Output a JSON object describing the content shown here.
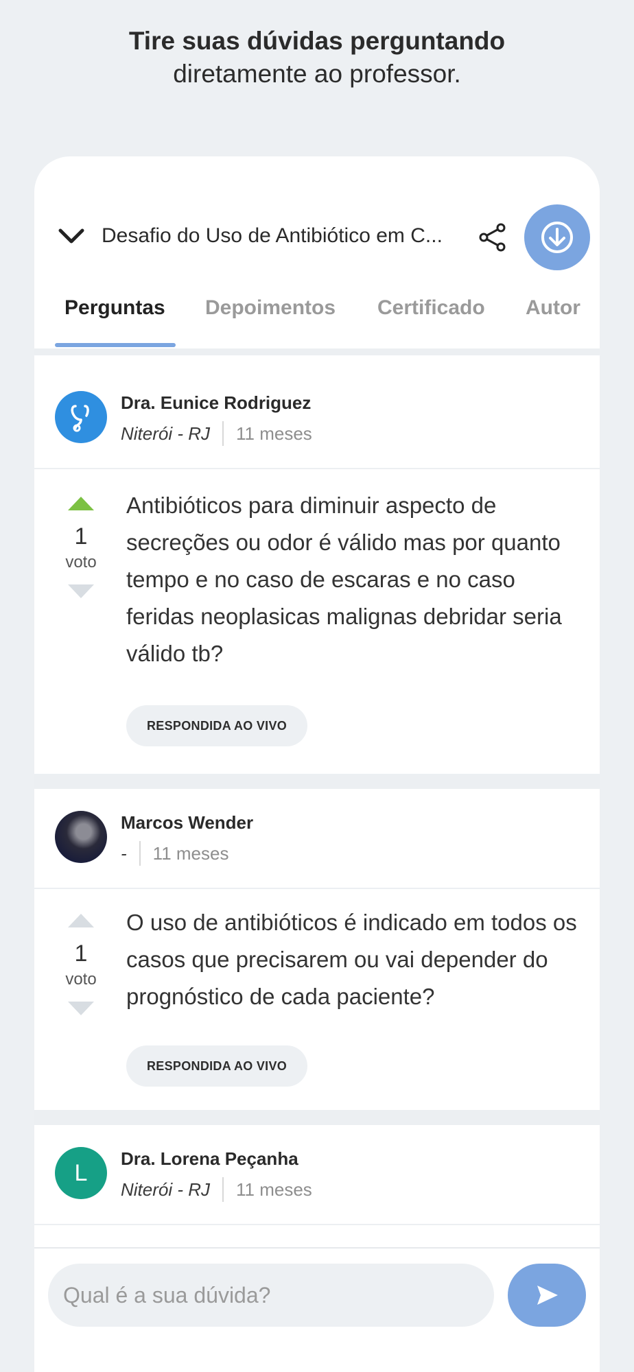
{
  "promo": {
    "headline_bold": "Tire suas dúvidas perguntando",
    "headline_normal": "diretamente ao professor."
  },
  "header": {
    "course_title": "Desafio do Uso de Antibiótico em C...",
    "icons": [
      "chevron-down-icon",
      "share-icon",
      "download-icon"
    ]
  },
  "tabs": [
    {
      "label": "Perguntas",
      "active": true
    },
    {
      "label": "Depoimentos",
      "active": false
    },
    {
      "label": "Certificado",
      "active": false
    },
    {
      "label": "Autor",
      "active": false
    }
  ],
  "questions": [
    {
      "author": "Dra. Eunice Rodriguez",
      "location": "Niterói - RJ",
      "time": "11 meses",
      "votes": "1",
      "vote_label": "voto",
      "upvoted": true,
      "text": "Antibióticos para diminuir aspecto de secreções ou odor é válido mas por quanto tempo e no caso de escaras e no caso feridas neoplasicas malignas debridar seria válido tb?",
      "badge": "RESPONDIDA AO VIVO"
    },
    {
      "author": "Marcos Wender",
      "location": "-",
      "time": "11 meses",
      "votes": "1",
      "vote_label": "voto",
      "upvoted": false,
      "text": "O uso de antibióticos é indicado em todos os casos que precisarem ou vai depender do prognóstico de cada paciente?",
      "badge": "RESPONDIDA AO VIVO"
    },
    {
      "author": "Dra. Lorena Peçanha",
      "location": "Niterói - RJ",
      "time": "11 meses",
      "avatar_letter": "L"
    }
  ],
  "composer": {
    "placeholder": "Qual é a sua dúvida?"
  },
  "colors": {
    "accent": "#7ba5e0",
    "upvote_active": "#7cc143",
    "avatar_blue": "#2f8fe0",
    "avatar_green": "#16a086",
    "background": "#edf0f3"
  }
}
